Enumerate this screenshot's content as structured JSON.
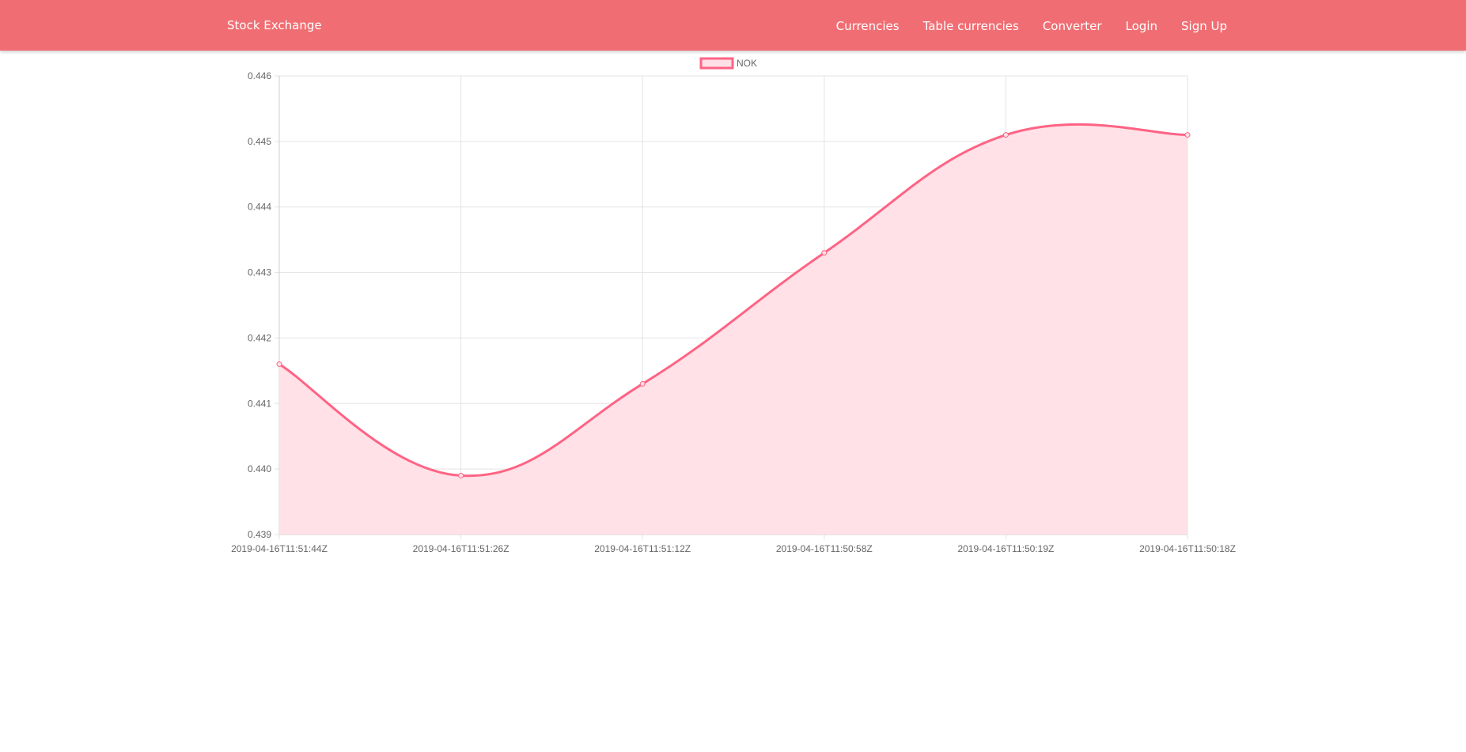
{
  "navbar": {
    "brand": "Stock Exchange",
    "links": [
      {
        "label": "Currencies"
      },
      {
        "label": "Table currencies"
      },
      {
        "label": "Converter"
      },
      {
        "label": "Login"
      },
      {
        "label": "Sign Up"
      }
    ]
  },
  "colors": {
    "navbar": "#f06e73",
    "line": "#ff6384",
    "fill": "#ffdfe6"
  },
  "chart_data": {
    "type": "line",
    "smoothed": true,
    "filled": true,
    "legend": "top-center",
    "grid": true,
    "categories": [
      "2019-04-16T11:51:44Z",
      "2019-04-16T11:51:26Z",
      "2019-04-16T11:51:12Z",
      "2019-04-16T11:50:58Z",
      "2019-04-16T11:50:19Z",
      "2019-04-16T11:50:18Z"
    ],
    "series": [
      {
        "name": "NOK",
        "values": [
          0.4416,
          0.4399,
          0.4413,
          0.4433,
          0.4451,
          0.4451
        ]
      }
    ],
    "ylim": [
      0.439,
      0.446
    ],
    "yticks": [
      "0.446",
      "0.445",
      "0.444",
      "0.443",
      "0.442",
      "0.441",
      "0.440",
      "0.439"
    ],
    "title": "",
    "xlabel": "",
    "ylabel": ""
  }
}
